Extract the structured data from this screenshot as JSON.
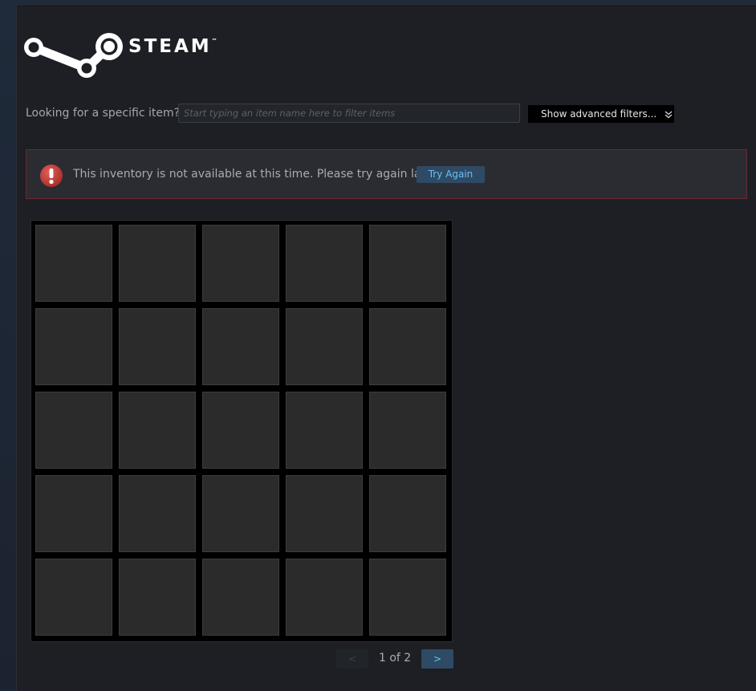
{
  "logo": {
    "wordmark": "STEAM",
    "trademark": "™"
  },
  "filter": {
    "label": "Looking for a specific item?",
    "placeholder": "Start typing an item name here to filter items",
    "advanced_label": "Show advanced filters...",
    "advanced_icon": "double-chevron-down-icon"
  },
  "error": {
    "icon": "error-exclamation-icon",
    "message": "This inventory is not available at this time. Please try again later.",
    "retry_label": "Try Again",
    "border_color": "#6a2a2e",
    "icon_color": "#c0392b"
  },
  "inventory": {
    "rows": 5,
    "columns": 5
  },
  "pager": {
    "prev_label": "<",
    "page_text": "1 of 2",
    "next_label": ">"
  },
  "colors": {
    "accent": "#67c1f5",
    "button_bg": "#2e4a64"
  }
}
